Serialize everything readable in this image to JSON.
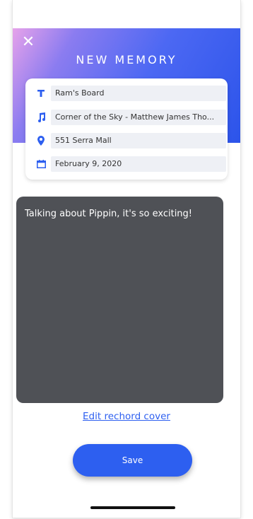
{
  "header": {
    "title": "NEW MEMORY",
    "close_glyph": "✕",
    "close_icon": "close-icon"
  },
  "form": {
    "fields": [
      {
        "icon": "title-text-icon",
        "value": "Ram's Board"
      },
      {
        "icon": "music-note-icon",
        "value": "Corner of the Sky - Matthew James Tho..."
      },
      {
        "icon": "location-pin-icon",
        "value": "551 Serra Mall"
      },
      {
        "icon": "calendar-icon",
        "value": "February 9, 2020"
      }
    ]
  },
  "notes": {
    "text": "Talking about Pippin, it's so exciting!"
  },
  "links": {
    "edit_cover": "Edit rechord cover"
  },
  "actions": {
    "save_label": "Save"
  },
  "colors": {
    "accent": "#2d5ff0",
    "notes_bg": "#4f5156",
    "field_bg": "#eef0f5"
  }
}
